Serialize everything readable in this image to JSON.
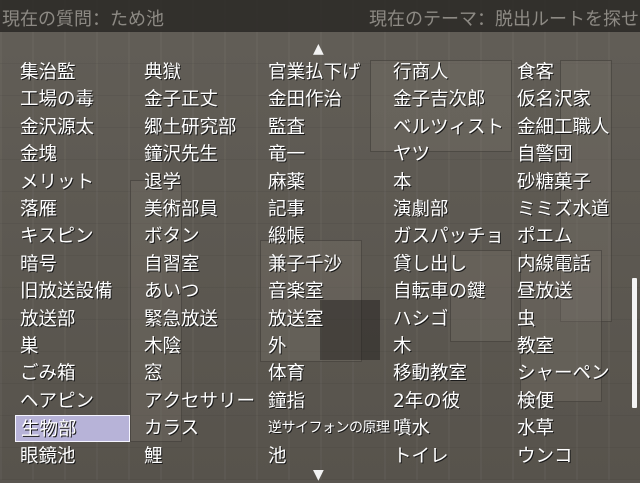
{
  "header": {
    "question": "現在の質問：ため池",
    "theme": "現在のテーマ：脱出ルートを探せ"
  },
  "arrows": {
    "up": "▲",
    "down": "▼"
  },
  "columns": [
    [
      "集治監",
      "工場の毒",
      "金沢源太",
      "金塊",
      "メリット",
      "落雁",
      "キスピン",
      "暗号",
      "旧放送設備",
      "放送部",
      "巣",
      "ごみ箱",
      "ヘアピン",
      "生物部",
      "眼鏡池"
    ],
    [
      "典獄",
      "金子正丈",
      "郷土研究部",
      "鐘沢先生",
      "退学",
      "美術部員",
      "ボタン",
      "自習室",
      "あいつ",
      "緊急放送",
      "木陰",
      "窓",
      "アクセサリー",
      "カラス",
      "鯉"
    ],
    [
      "官業払下げ",
      "金田作治",
      "監査",
      "竜一",
      "麻薬",
      "記事",
      "緞帳",
      "兼子千沙",
      "音楽室",
      "放送室",
      "外",
      "体育",
      "鐘指",
      "逆サイフォンの原理",
      "池"
    ],
    [
      "行商人",
      "金子吉次郎",
      "ベルツィスト",
      "ヤツ",
      "本",
      "演劇部",
      "ガスパッチョ",
      "貸し出し",
      "自転車の鍵",
      "ハシゴ",
      "木",
      "移動教室",
      "2年の彼",
      "噴水",
      "トイレ"
    ],
    [
      "食客",
      "仮名沢家",
      "金細工職人",
      "自警団",
      "砂糖菓子",
      "ミミズ水道",
      "ポエム",
      "内線電話",
      "昼放送",
      "虫",
      "教室",
      "シャーペン",
      "検便",
      "水草",
      "ウンコ"
    ]
  ],
  "selected": "生物部"
}
